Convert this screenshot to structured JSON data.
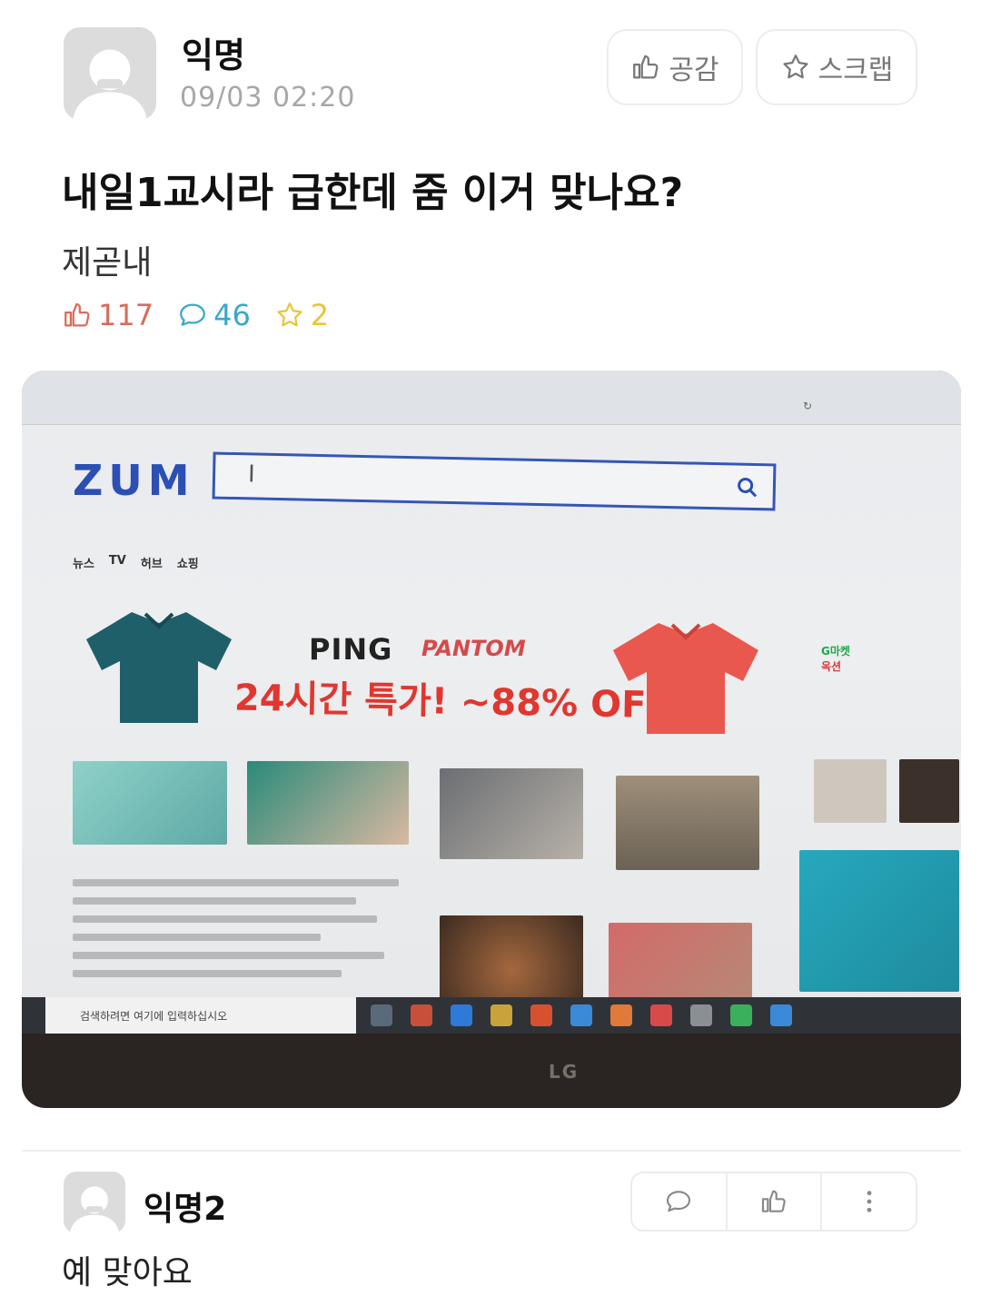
{
  "post": {
    "author": "익명",
    "time": "09/03 02:20",
    "like_button": "공감",
    "scrap_button": "스크랩",
    "title": "내일1교시라 급한데 줌 이거 맞나요?",
    "body": "제곧내",
    "stats": {
      "likes": "117",
      "comments": "46",
      "scraps": "2"
    },
    "colors": {
      "like": "#d96b5a",
      "comment": "#3aa7c9",
      "scrap": "#e8c53a"
    }
  },
  "photo": {
    "zum_logo": "ZUM",
    "ad_brand": "PING",
    "ad_brand2": "PANTOM",
    "ad_deal": "24시간 특가! ~88% OFF!",
    "nav_items": [
      "뉴스",
      "TV",
      "허브",
      "쇼핑"
    ],
    "taskbar_search": "검색하려면 여기에 입력하십시오",
    "portal_links": [
      "G마켓",
      "옥션"
    ],
    "bezel_logo": "LG"
  },
  "comment": {
    "author": "익명2",
    "text": "예 맞아요"
  }
}
